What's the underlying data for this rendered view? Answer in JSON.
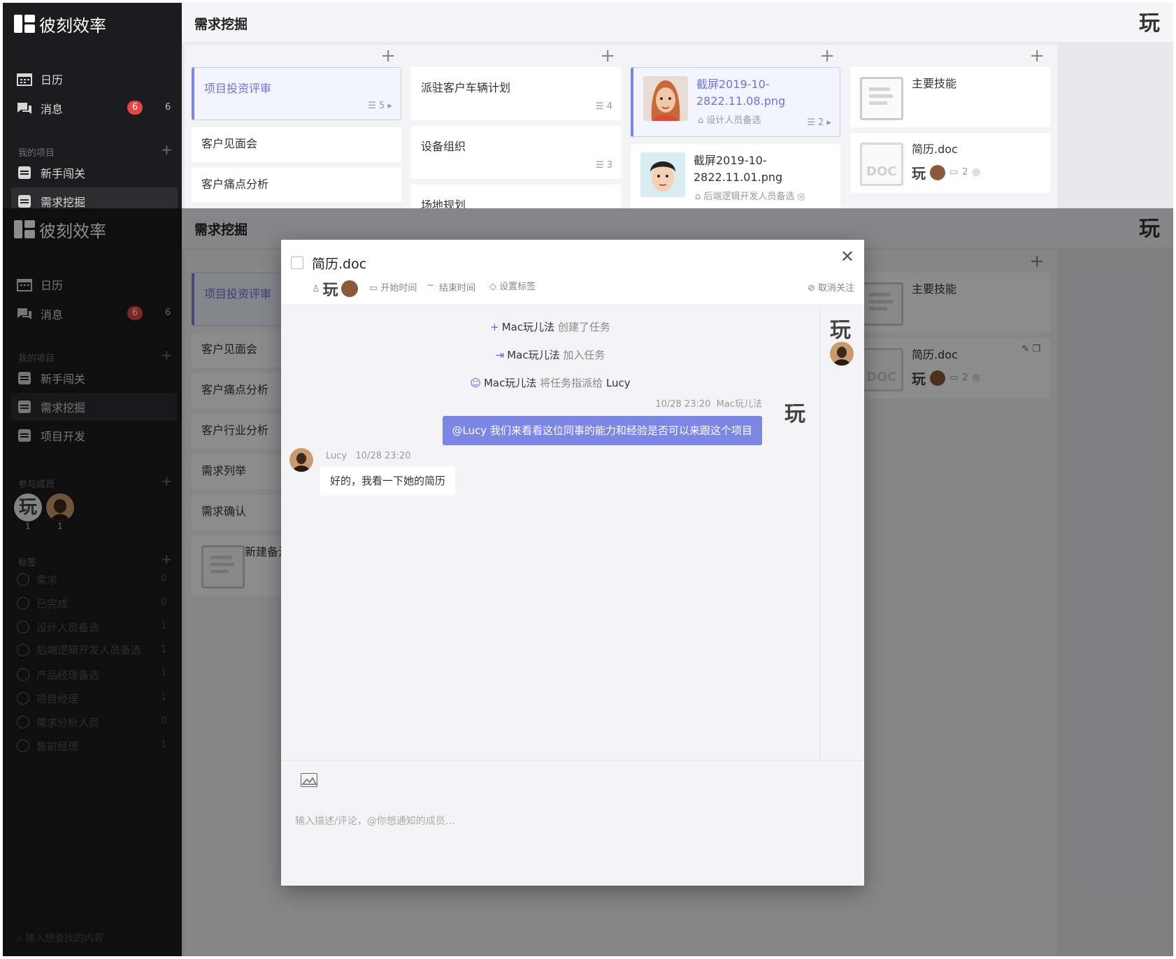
{
  "app": {
    "name": "彼刻效率",
    "page_title": "需求挖掘"
  },
  "sidebar": {
    "nav": [
      {
        "label": "日历"
      },
      {
        "label": "消息",
        "badge": "6",
        "count": "6"
      }
    ],
    "my_projects_header": "我的项目",
    "projects": [
      "新手闯关",
      "需求挖掘",
      "项目开发"
    ],
    "members_header": "参与成员",
    "members": [
      {
        "avatar": "玩",
        "count": "1"
      },
      {
        "avatar": "",
        "count": "1"
      }
    ],
    "tags_header": "标签",
    "tags": [
      {
        "label": "需求",
        "count": "0"
      },
      {
        "label": "已完成",
        "count": "0"
      },
      {
        "label": "设计人员备选",
        "count": "1"
      },
      {
        "label": "后端逻辑开发人员备选",
        "count": "1"
      },
      {
        "label": "产品经理备选",
        "count": "1"
      },
      {
        "label": "项目经理",
        "count": "1"
      },
      {
        "label": "需求分析人员",
        "count": "0"
      },
      {
        "label": "售前经理",
        "count": "1"
      }
    ],
    "search_placeholder": "输入想查找的内容"
  },
  "board": {
    "columns": [
      {
        "cards": [
          {
            "title": "项目投资评审",
            "meta": "5",
            "selected": true
          },
          {
            "title": "客户见面会"
          },
          {
            "title": "客户痛点分析"
          },
          {
            "title": "客户行业分析"
          },
          {
            "title": "需求列举"
          },
          {
            "title": "需求确认"
          },
          {
            "title": "新建备注"
          }
        ]
      },
      {
        "cards": [
          {
            "title": "派驻客户车辆计划",
            "meta": "4"
          },
          {
            "title": "设备组织",
            "meta": "3"
          },
          {
            "title": "场地规划"
          }
        ]
      },
      {
        "cards": [
          {
            "title": "截屏2019-10-2822.11.08.png",
            "line1": "截屏2019-10-",
            "line2": "2822.11.08.png",
            "tag": "设计人员备选",
            "meta": "2",
            "selected": true
          },
          {
            "title": "截屏2019-10-2822.11.01.png",
            "line1": "截屏2019-10-",
            "line2": "2822.11.01.png",
            "tag": "后端逻辑开发人员备选"
          }
        ]
      },
      {
        "cards": [
          {
            "title": "主要技能"
          },
          {
            "title": "简历.doc",
            "comments": "2"
          }
        ]
      }
    ]
  },
  "modal": {
    "title": "简历.doc",
    "start_time": "开始时间",
    "tilde": "~",
    "end_time": "结束时间",
    "set_tag": "设置标签",
    "unfollow": "取消关注",
    "activities": [
      {
        "icon": "+",
        "user": "Mac玩儿法",
        "action": "创建了任务"
      },
      {
        "icon": "⇥",
        "user": "Mac玩儿法",
        "action": "加入任务"
      },
      {
        "icon": "☺",
        "user": "Mac玩儿法",
        "action": "将任务指派给",
        "target": "Lucy"
      }
    ],
    "messages": [
      {
        "time": "10/28 23:20",
        "author": "Mac玩儿法",
        "text": "@Lucy 我们来看看这位同事的能力和经验是否可以来跟这个项目"
      },
      {
        "author": "Lucy",
        "time": "10/28 23:20",
        "text": "好的，我看一下她的简历"
      }
    ],
    "input_placeholder": "输入描述/评论，@你想通知的成员…"
  },
  "colors": {
    "accent": "#7b87e3",
    "sidebar_bg": "#1c1c1e",
    "badge": "#e64545"
  }
}
